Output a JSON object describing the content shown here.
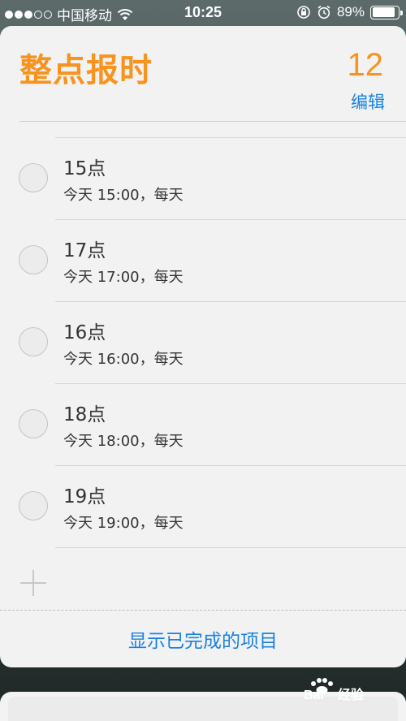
{
  "status_bar": {
    "carrier": "中国移动",
    "time": "10:25",
    "battery_percent": "89%",
    "battery_level": 0.89,
    "icons": [
      "signal-dots-icon",
      "wifi-icon",
      "rotation-lock-icon",
      "alarm-icon",
      "battery-icon"
    ]
  },
  "widget": {
    "title": "整点报时",
    "count": "12",
    "edit_label": "编辑",
    "accent_color": "#f7931e",
    "link_color": "#1a82e2",
    "reminders": [
      {
        "title": "15点",
        "subtitle": "今天 15:00，每天"
      },
      {
        "title": "17点",
        "subtitle": "今天 17:00，每天"
      },
      {
        "title": "16点",
        "subtitle": "今天 16:00，每天"
      },
      {
        "title": "18点",
        "subtitle": "今天 18:00，每天"
      },
      {
        "title": "19点",
        "subtitle": "今天 19:00，每天"
      }
    ],
    "show_completed_label": "显示已完成的项目"
  },
  "watermark": {
    "logo_text": "Bai 经验"
  }
}
